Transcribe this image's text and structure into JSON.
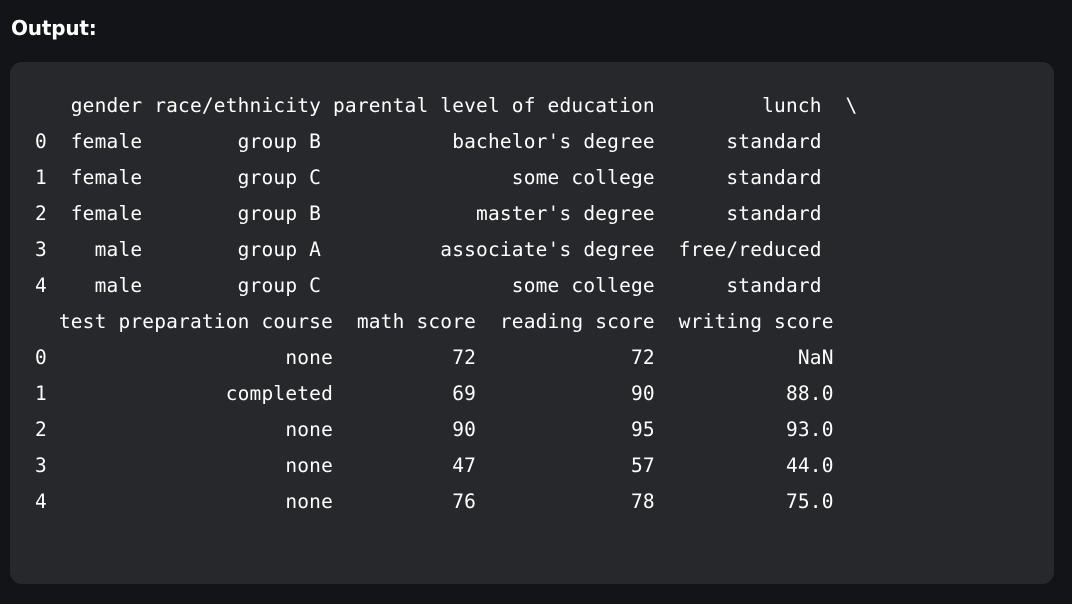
{
  "heading": "Output:",
  "output": {
    "lines": [
      "   gender race/ethnicity parental level of education         lunch  \\",
      "0  female        group B           bachelor's degree      standard   ",
      "1  female        group C                some college      standard   ",
      "2  female        group B             master's degree      standard   ",
      "3    male        group A          associate's degree  free/reduced   ",
      "4    male        group C                some college      standard   ",
      "  test preparation course  math score  reading score  writing score",
      "0                    none          72             72            NaN",
      "1               completed          69             90           88.0",
      "2                    none          90             95           93.0",
      "3                    none          47             57           44.0",
      "4                    none          76             78           75.0"
    ]
  }
}
